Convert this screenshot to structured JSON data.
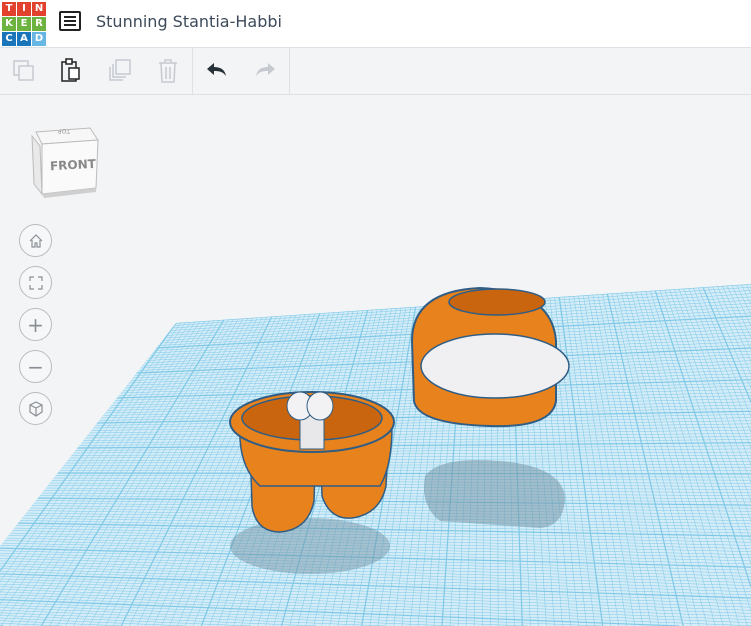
{
  "app": {
    "logo_letters": [
      "T",
      "I",
      "N",
      "K",
      "E",
      "R",
      "C",
      "A",
      "D"
    ],
    "logo_colors": [
      "#e2412d",
      "#e2412d",
      "#e2412d",
      "#6db33f",
      "#6db33f",
      "#6db33f",
      "#1b75bb",
      "#1b75bb",
      "#68b6e4"
    ]
  },
  "header": {
    "title": "Stunning Stantia-Habbi"
  },
  "toolbar": {
    "buttons": [
      "copy",
      "paste",
      "duplicate",
      "delete",
      "undo",
      "redo"
    ]
  },
  "viewcube": {
    "front": "FRONT",
    "top": "TOP"
  },
  "nav": {
    "buttons": [
      "home",
      "fit",
      "zoom-in",
      "zoom-out",
      "perspective"
    ]
  },
  "colors": {
    "grid": "#7fc8e6",
    "workplane": "#cfeaf6",
    "orange": "#e8821c",
    "outline": "#2f5d86"
  }
}
